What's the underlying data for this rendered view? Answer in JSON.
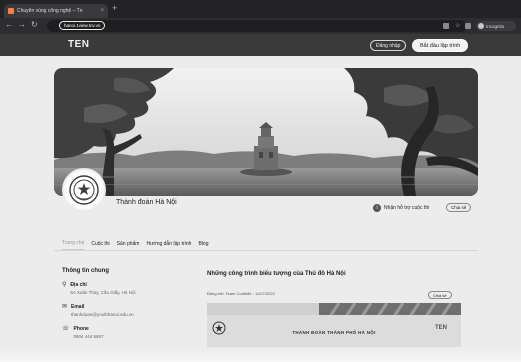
{
  "browser": {
    "tab_title": "Chuyển vùng công nghệ – Tn",
    "tab_close": "×",
    "new_tab": "+",
    "back": "←",
    "forward": "→",
    "reload": "↻",
    "url": "hanoi.1view.tnv.vn",
    "profile": "Incognito"
  },
  "site": {
    "logo": "TEN",
    "login_label": "Đăng nhập",
    "start_label": "Bắt đầu lập trình"
  },
  "profile": {
    "name": "Thành đoàn Hà Nội",
    "follow_count_label": "Nhận hỗ trợ cuộc thi",
    "share_label": "Chia sẻ"
  },
  "tabs": [
    {
      "label": "Trang chủ",
      "active": true
    },
    {
      "label": "Cuộc thi",
      "active": false
    },
    {
      "label": "Sản phẩm",
      "active": false
    },
    {
      "label": "Hướng dẫn lập trình",
      "active": false
    },
    {
      "label": "Blog",
      "active": false
    }
  ],
  "info": {
    "title": "Thông tin chung",
    "address_label": "Địa chỉ",
    "address_value": "5A Xuân Thủy, Cầu Giấy, Hà Nội",
    "email_label": "Email",
    "email_value": "thanhdoan@youthhanoi.edu.vn",
    "phone_label": "Phone",
    "phone_value": "0904 444 5657"
  },
  "card": {
    "title": "Những công trình biểu tượng của Thủ đô Hà Nội",
    "meta": "Đăng bởi: Team CodeMe · 11/07/2022",
    "share_label": "Chia sẻ",
    "banner_text": "THÀNH ĐOÀN THÀNH PHỐ HÀ NỘI",
    "banner_right_logo": "TEN"
  },
  "colors": {
    "browser_chrome": "#232325",
    "site_header": "#3a3a3a",
    "page_bg": "#ececec",
    "banner": "#dcdcdc"
  }
}
